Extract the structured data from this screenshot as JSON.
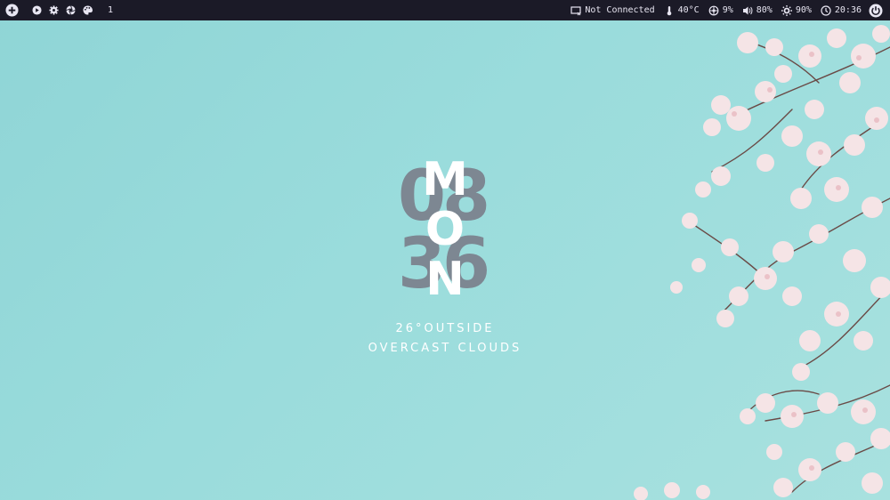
{
  "topbar": {
    "left": {
      "launcher_icon": "plus-circle-icon",
      "apps": [
        {
          "name": "play-icon"
        },
        {
          "name": "gear-icon"
        },
        {
          "name": "aperture-icon"
        },
        {
          "name": "palette-icon"
        }
      ],
      "workspace": "1"
    },
    "right": {
      "network": {
        "icon": "network-disconnected-icon",
        "label": "Not Connected"
      },
      "temperature": {
        "icon": "thermometer-icon",
        "label": "40°C"
      },
      "cpu": {
        "icon": "cpu-icon",
        "label": "9%"
      },
      "volume": {
        "icon": "speaker-icon",
        "label": "80%"
      },
      "brightness": {
        "icon": "brightness-icon",
        "label": "90%"
      },
      "clock": {
        "icon": "clock-icon",
        "label": "20:36"
      },
      "power_icon": "power-icon"
    }
  },
  "widget": {
    "hour_digits": [
      "0",
      "8"
    ],
    "minute_digits": [
      "3",
      "6"
    ],
    "day_letters": [
      "M",
      "O",
      "N"
    ],
    "temperature_line": "26°OUTSIDE",
    "condition_line": "OVERCAST CLOUDS"
  },
  "colors": {
    "bar_bg": "#1b1a27",
    "bar_text": "#e8e6f2",
    "sky": "#9adcdc",
    "digits": "#7a7e8a",
    "letters": "#ffffff"
  }
}
